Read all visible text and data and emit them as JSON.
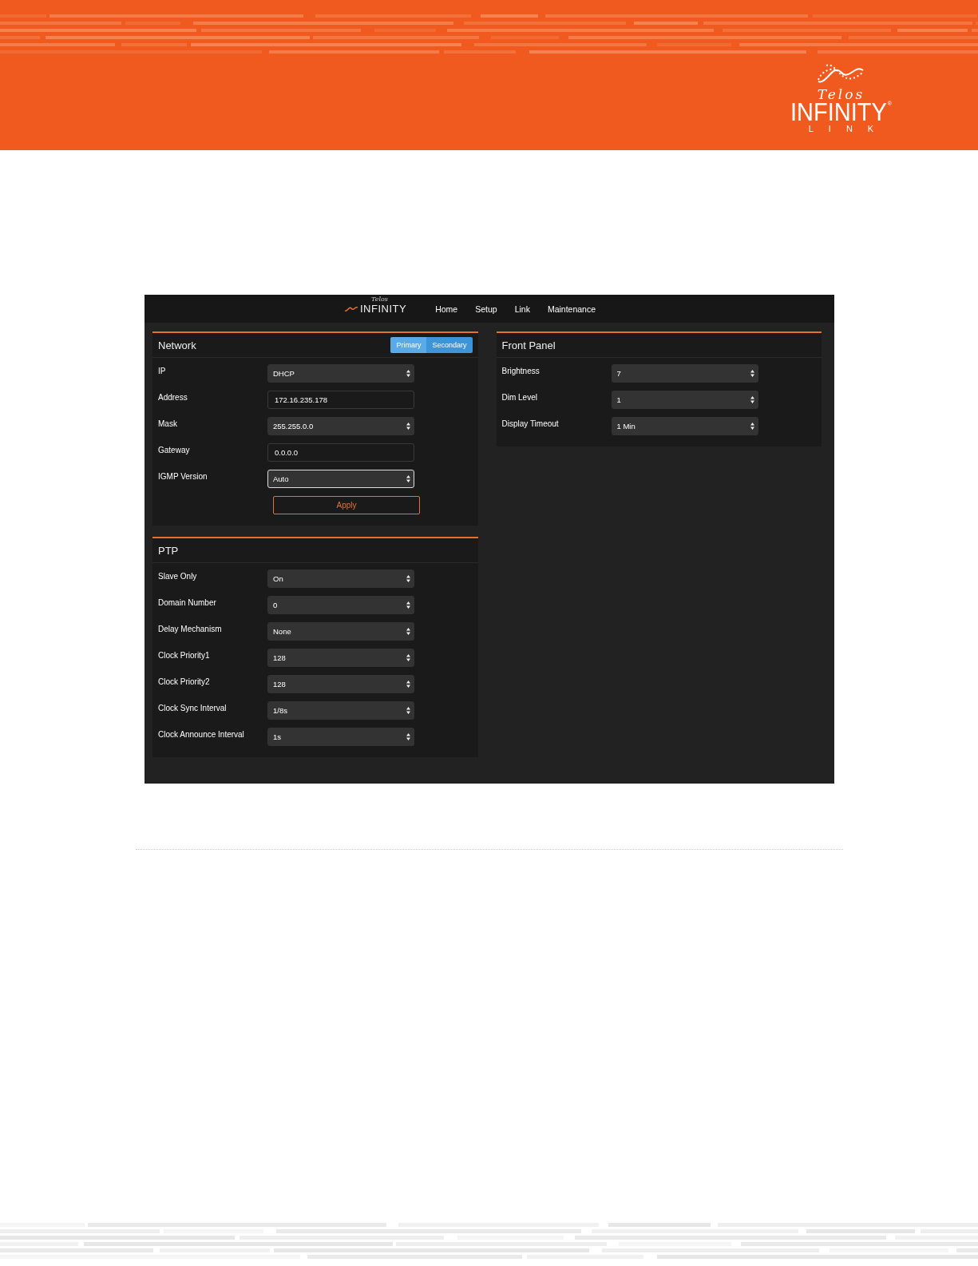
{
  "banner": {
    "logo": {
      "script": "Telos",
      "wordmark": "INFINITY",
      "registered": "®",
      "subtitle": "LINK"
    }
  },
  "app": {
    "navbar": {
      "logo": {
        "script": "Telos",
        "wordmark": "INFINITY"
      },
      "items": [
        "Home",
        "Setup",
        "Link",
        "Maintenance"
      ]
    },
    "columns": [
      [
        {
          "title": "Network",
          "toggle": [
            {
              "label": "Primary",
              "selected": true
            },
            {
              "label": "Secondary",
              "selected": false
            }
          ],
          "fields": [
            {
              "label": "IP",
              "kind": "select",
              "value": "DHCP",
              "focused": false
            },
            {
              "label": "Address",
              "kind": "text",
              "value": "172.16.235.178",
              "focused": false
            },
            {
              "label": "Mask",
              "kind": "select",
              "value": "255.255.0.0",
              "focused": false
            },
            {
              "label": "Gateway",
              "kind": "text",
              "value": "0.0.0.0",
              "focused": false
            },
            {
              "label": "IGMP Version",
              "kind": "select",
              "value": "Auto",
              "focused": true
            }
          ],
          "button": "Apply"
        },
        {
          "title": "PTP",
          "fields": [
            {
              "label": "Slave Only",
              "kind": "select",
              "value": "On",
              "focused": false
            },
            {
              "label": "Domain Number",
              "kind": "select",
              "value": "0",
              "focused": false
            },
            {
              "label": "Delay Mechanism",
              "kind": "select",
              "value": "None",
              "focused": false
            },
            {
              "label": "Clock Priority1",
              "kind": "select",
              "value": "128",
              "focused": false
            },
            {
              "label": "Clock Priority2",
              "kind": "select",
              "value": "128",
              "focused": false
            },
            {
              "label": "Clock Sync Interval",
              "kind": "select",
              "value": "1/8s",
              "focused": false
            },
            {
              "label": "Clock Announce Interval",
              "kind": "select",
              "value": "1s",
              "focused": false
            }
          ]
        }
      ],
      [
        {
          "title": "Front Panel",
          "fields": [
            {
              "label": "Brightness",
              "kind": "select",
              "value": "7",
              "focused": false
            },
            {
              "label": "Dim Level",
              "kind": "select",
              "value": "1",
              "focused": false
            },
            {
              "label": "Display Timeout",
              "kind": "select",
              "value": "1 Min",
              "focused": false
            }
          ]
        }
      ]
    ]
  }
}
